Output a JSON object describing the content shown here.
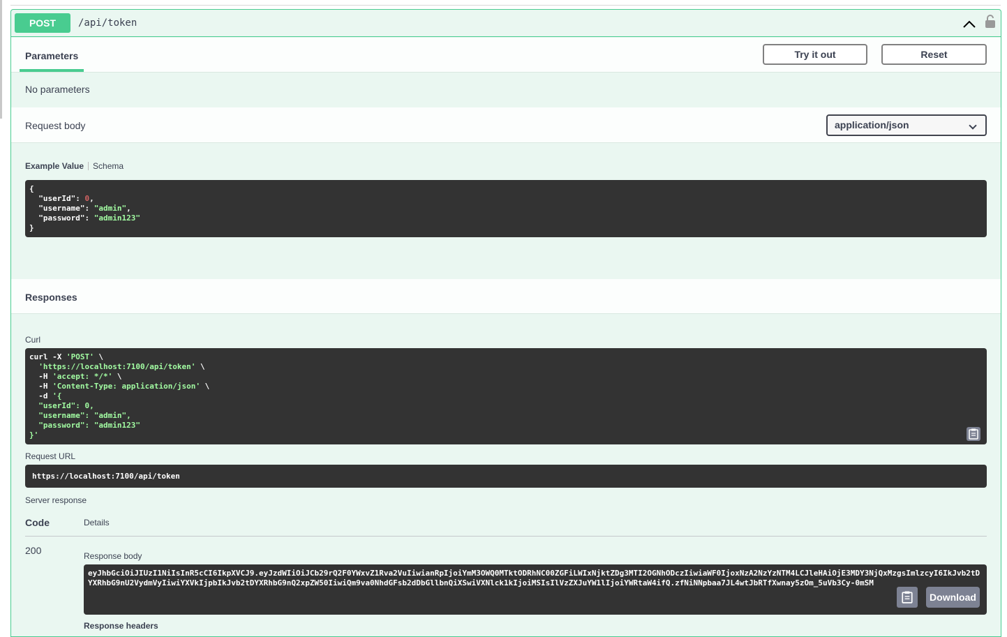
{
  "operation": {
    "method": "POST",
    "path": "/api/token"
  },
  "parameters": {
    "tab_label": "Parameters",
    "try_label": "Try it out",
    "reset_label": "Reset",
    "empty_text": "No parameters"
  },
  "request_body": {
    "label": "Request body",
    "content_type": "application/json",
    "example_tab": "Example Value",
    "schema_tab": "Schema",
    "example": {
      "userId": "0",
      "username": "\"admin\"",
      "password": "\"admin123\""
    }
  },
  "responses": {
    "title": "Responses",
    "curl_label": "Curl",
    "curl": {
      "line1_cmd": "curl -X ",
      "line1_method": "'POST'",
      "line2_url": "'https://localhost:7100/api/token'",
      "line3_flag": "-H ",
      "line3_val": "'accept: */*'",
      "line4_flag": "-H ",
      "line4_val": "'Content-Type: application/json'",
      "line5_flag": "-d ",
      "line5_val": "'{",
      "body_userId": "\"userId\": 0,",
      "body_username": "\"username\": \"admin\",",
      "body_password": "\"password\": \"admin123\"",
      "body_end": "}'"
    },
    "request_url_label": "Request URL",
    "request_url": "https://localhost:7100/api/token",
    "server_response_label": "Server response",
    "code_header": "Code",
    "details_header": "Details",
    "status_code": "200",
    "response_body_label": "Response body",
    "response_body": "eyJhbGciOiJIUzI1NiIsInR5cCI6IkpXVCJ9.eyJzdWIiOiJCb29rQ2F0YWxvZ1Rva2VuIiwianRpIjoiYmM3OWQ0MTktODRhNC00ZGFiLWIxNjktZDg3MTI2OGNhODczIiwiaWF0IjoxNzA2NzYzNTM4LCJleHAiOjE3MDY3NjQxMzgsImlzcyI6IkJvb2tDYXRhbG9nU2VydmVyIiwiYXVkIjpbIkJvb2tDYXRhbG9nQ2xpZW50IiwiQm9va0NhdGFsb2dDbGllbnQiXSwiVXNlck1kIjoiMSIsIlVzZXJuYW1lIjoiYWRtaW4ifQ.zfNiNNpbaa7JL4wtJbRTfXwnay5zOm_5uVb3Cy-0mSM",
    "download_label": "Download",
    "response_headers_label": "Response headers"
  }
}
